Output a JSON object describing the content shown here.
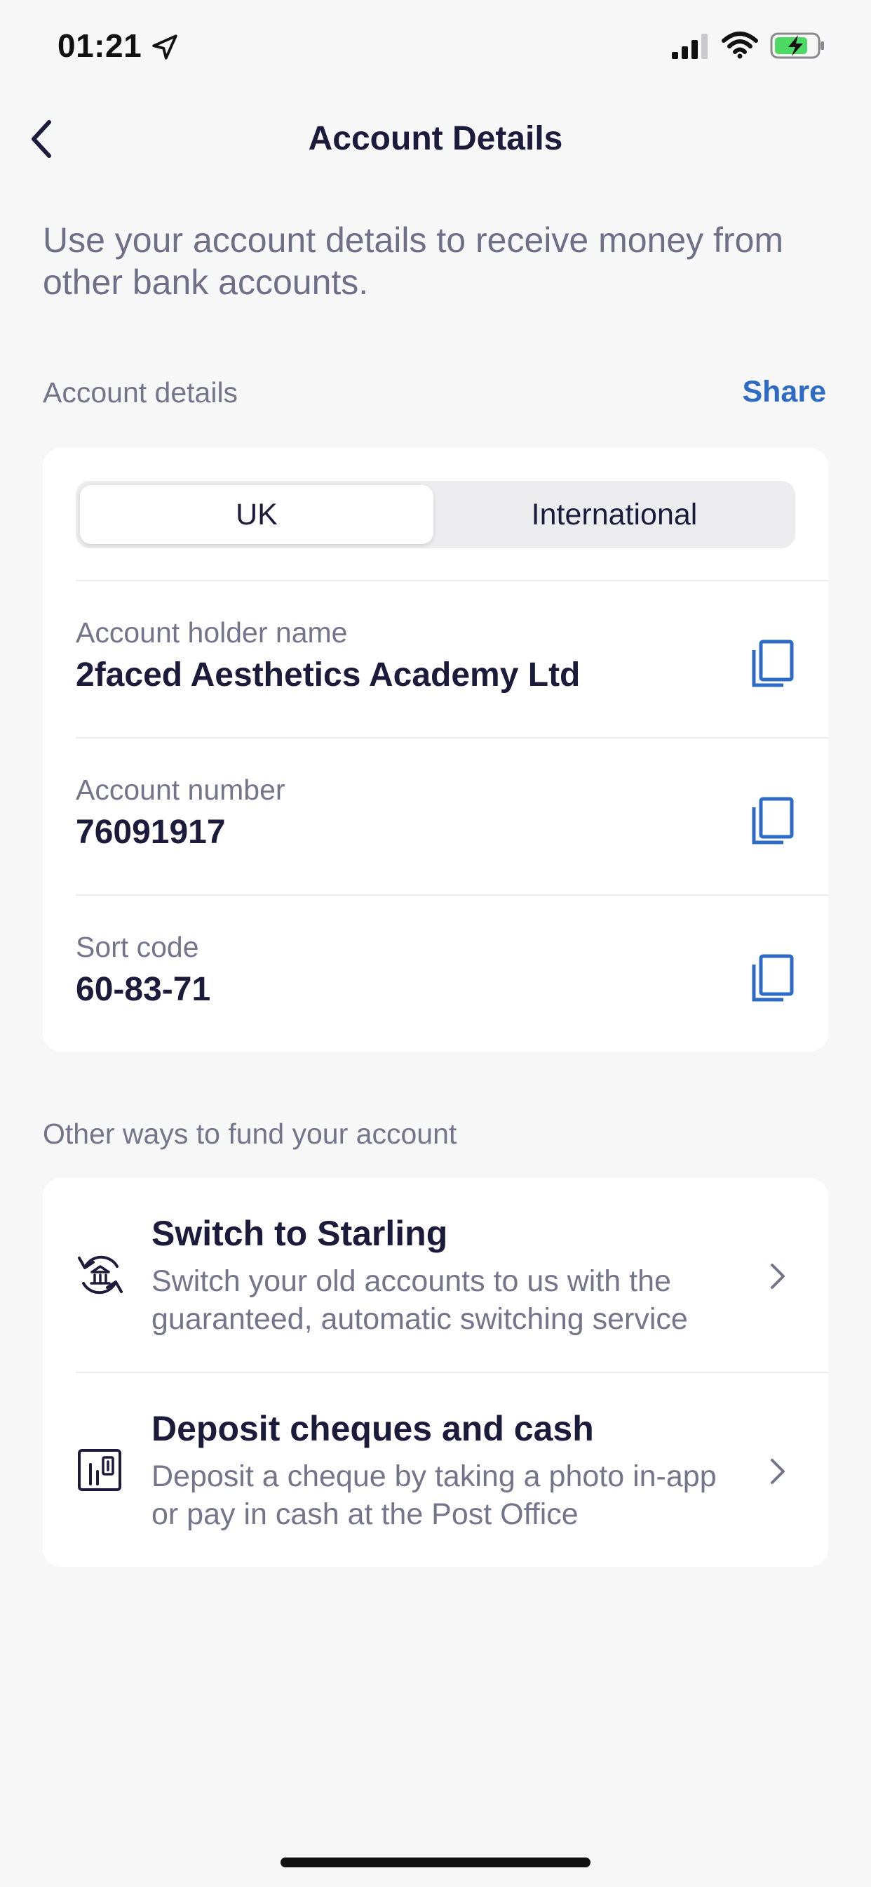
{
  "status_bar": {
    "time": "01:21",
    "icons": [
      "location-arrow-icon",
      "signal-bars-icon",
      "wifi-icon",
      "battery-charging-icon"
    ]
  },
  "header": {
    "title": "Account Details",
    "back_icon": "chevron-left-icon"
  },
  "intro_text": "Use your account details to receive money from other bank accounts.",
  "account_section": {
    "label": "Account details",
    "share_label": "Share",
    "tabs": [
      {
        "label": "UK",
        "selected": true
      },
      {
        "label": "International",
        "selected": false
      }
    ],
    "fields": [
      {
        "label": "Account holder name",
        "value": "2faced Aesthetics Academy Ltd"
      },
      {
        "label": "Account number",
        "value": "76091917"
      },
      {
        "label": "Sort code",
        "value": "60-83-71"
      }
    ],
    "copy_icon": "copy-icon"
  },
  "fund_section": {
    "label": "Other ways to fund your account",
    "items": [
      {
        "title": "Switch to Starling",
        "description": "Switch your old accounts to us with the guaranteed, automatic switching service",
        "icon": "bank-switch-icon"
      },
      {
        "title": "Deposit cheques and cash",
        "description": "Deposit a cheque by taking a photo in-app or pay in cash at the Post Office",
        "icon": "cheque-deposit-icon"
      }
    ]
  },
  "colors": {
    "accent": "#2d6bc4",
    "background": "#f7f7f8",
    "card": "#ffffff",
    "text_primary": "#1d1b3b",
    "text_secondary": "#74758a"
  }
}
